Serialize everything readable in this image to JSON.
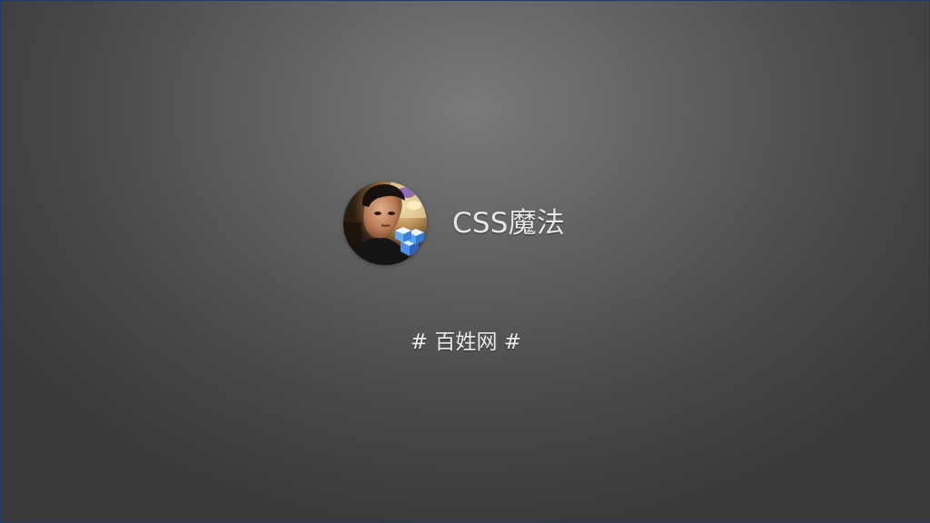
{
  "slide": {
    "title": "CSS魔法",
    "subtitle": "# 百姓网 #"
  },
  "avatar": {
    "icon": "profile-photo",
    "badge_icon": "blue-cube-icon"
  },
  "colors": {
    "background_center": "#7a7a7a",
    "background_edge": "#3a3a3a",
    "frame_border": "#22396a",
    "text": "#e6e6e6"
  }
}
